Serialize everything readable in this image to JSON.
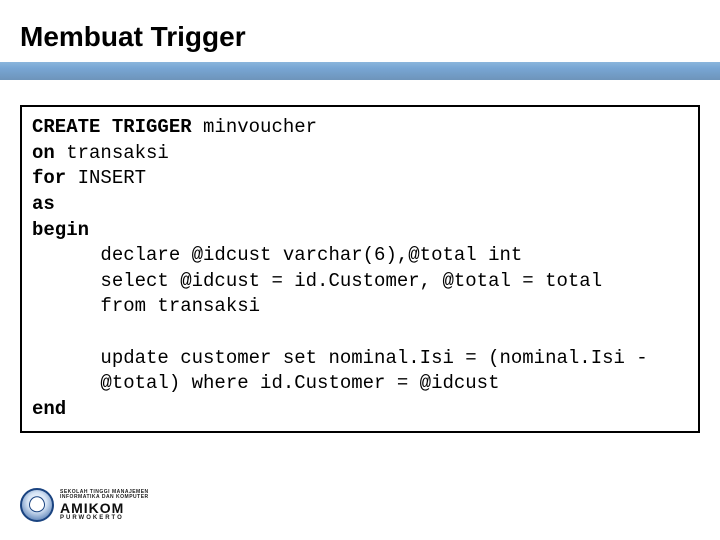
{
  "slide": {
    "title": "Membuat Trigger"
  },
  "code": {
    "l1a": "CREATE TRIGGER",
    "l1b": " minvoucher",
    "l2a": "on",
    "l2b": " transaksi",
    "l3a": "for",
    "l3b": " INSERT",
    "l4": "as",
    "l5": "begin",
    "l6": "      declare @idcust varchar(6),@total int",
    "l7": "      select @idcust = id.Customer, @total = total",
    "l8": "      from transaksi",
    "blank": "",
    "l9": "      update customer set nominal.Isi = (nominal.Isi -",
    "l10": "      @total) where id.Customer = @idcust",
    "l11": "end"
  },
  "footer": {
    "line1": "SEKOLAH TINGGI MANAJEMEN",
    "line2": "INFORMATIKA DAN KOMPUTER",
    "main": "AMIKOM",
    "sub": "PURWOKERTO"
  }
}
